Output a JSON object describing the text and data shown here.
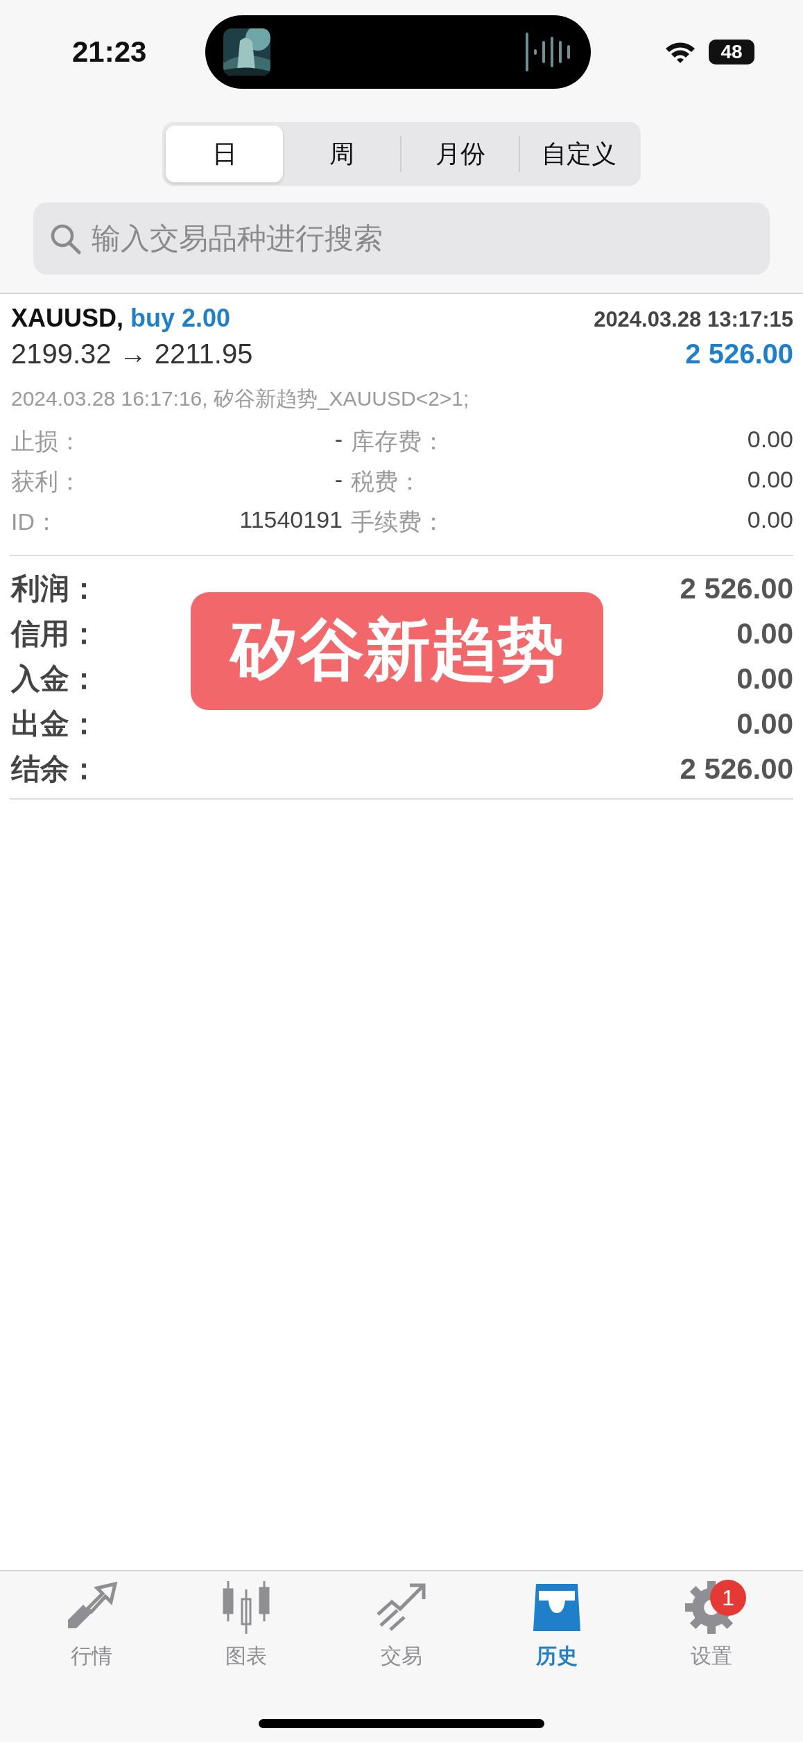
{
  "status_bar": {
    "time": "21:23",
    "battery": "48"
  },
  "period_tabs": [
    {
      "label": "日",
      "selected": true
    },
    {
      "label": "周",
      "selected": false
    },
    {
      "label": "月份",
      "selected": false
    },
    {
      "label": "自定义",
      "selected": false
    }
  ],
  "search": {
    "placeholder": "输入交易品种进行搜索"
  },
  "deal": {
    "symbol": "XAUUSD,",
    "side": "buy 2.00",
    "time": "2024.03.28 13:17:15",
    "prices": "2199.32 → 2211.95",
    "profit": "2 526.00",
    "comment": "2024.03.28 16:17:16, 矽谷新趋势_XAUUSD<2>1;",
    "details": [
      {
        "left": {
          "label": "止损：",
          "value": "-"
        },
        "right": {
          "label": "库存费：",
          "value": "0.00"
        }
      },
      {
        "left": {
          "label": "获利：",
          "value": "-"
        },
        "right": {
          "label": "税费：",
          "value": "0.00"
        }
      },
      {
        "left": {
          "label": "ID：",
          "value": "11540191"
        },
        "right": {
          "label": "手续费：",
          "value": "0.00"
        }
      }
    ]
  },
  "summary": [
    {
      "label": "利润：",
      "value": "2 526.00"
    },
    {
      "label": "信用：",
      "value": "0.00"
    },
    {
      "label": "入金：",
      "value": "0.00"
    },
    {
      "label": "出金：",
      "value": "0.00"
    },
    {
      "label": "结余：",
      "value": "2 526.00"
    }
  ],
  "stamp": {
    "text": "矽谷新趋势"
  },
  "tab_bar": [
    {
      "kind": "quotes",
      "label": "行情",
      "selected": false
    },
    {
      "kind": "chart",
      "label": "图表",
      "selected": false
    },
    {
      "kind": "trade",
      "label": "交易",
      "selected": false
    },
    {
      "kind": "history",
      "label": "历史",
      "selected": true
    },
    {
      "kind": "settings",
      "label": "设置",
      "selected": false,
      "badge": "1"
    }
  ]
}
